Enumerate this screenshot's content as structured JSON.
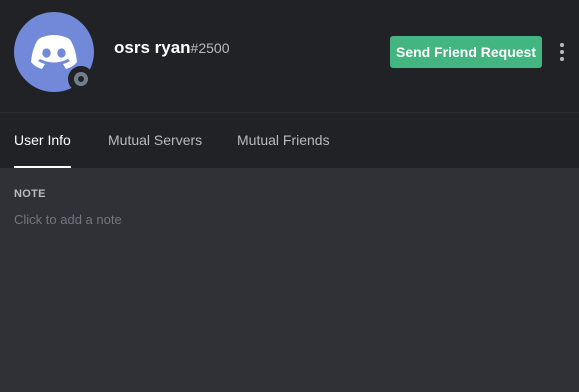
{
  "user": {
    "username": "osrs ryan",
    "discriminator": "#2500",
    "status": "offline"
  },
  "actions": {
    "send_friend_request_label": "Send Friend Request",
    "more_icon": "more-vertical-icon"
  },
  "tabs": [
    {
      "label": "User Info",
      "active": true
    },
    {
      "label": "Mutual Servers",
      "active": false
    },
    {
      "label": "Mutual Friends",
      "active": false
    }
  ],
  "note": {
    "header": "NOTE",
    "placeholder": "Click to add a note",
    "value": ""
  },
  "colors": {
    "header_bg": "#202225",
    "body_bg": "#2f3136",
    "avatar_bg": "#7289da",
    "button_bg": "#43b581",
    "status_offline": "#747f8d"
  },
  "icons": {
    "avatar": "discord-logo-icon",
    "status": "status-offline-icon"
  }
}
